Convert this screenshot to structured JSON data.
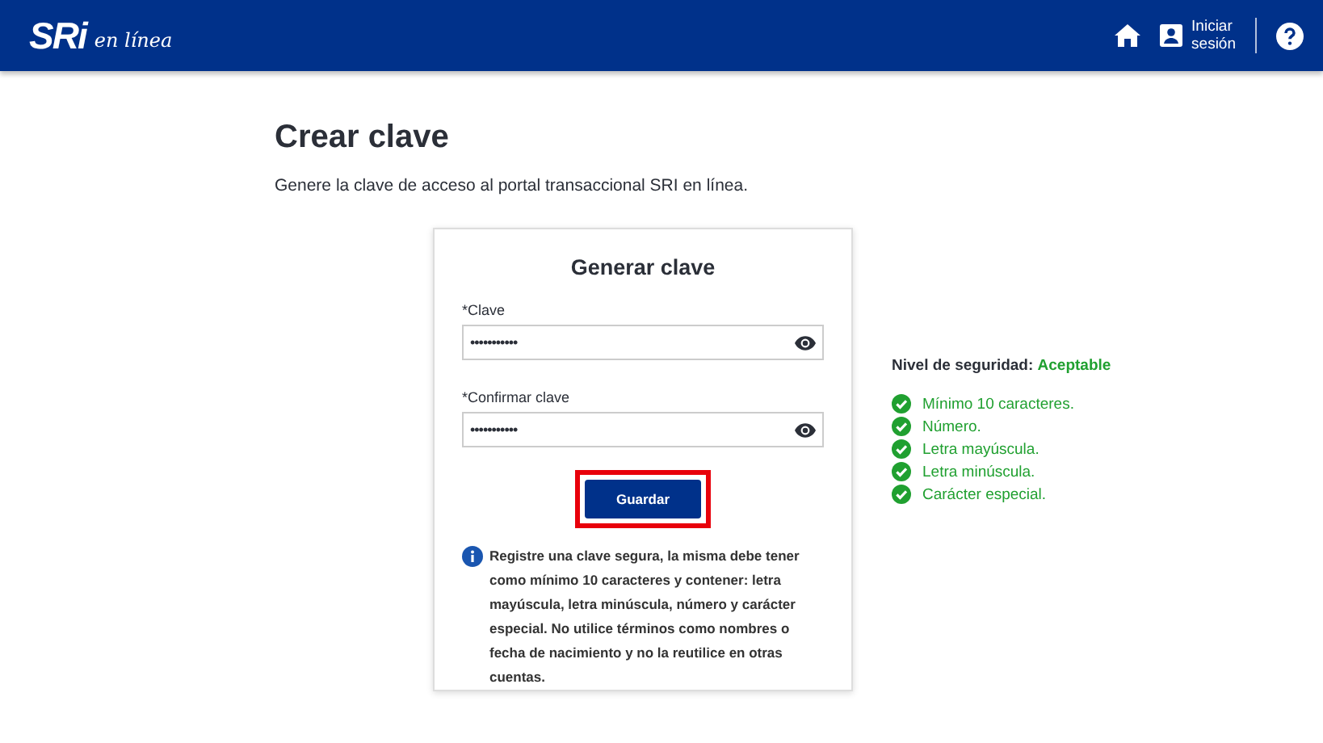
{
  "header": {
    "logo": "SRi",
    "logo_sub": "en línea",
    "login": [
      "Iniciar",
      "sesión"
    ]
  },
  "page": {
    "title": "Crear clave",
    "subtitle": "Genere la clave de acceso al portal transaccional SRI en línea."
  },
  "card": {
    "title": "Generar clave",
    "fields": [
      {
        "label": "*Clave",
        "value": "•••••••••••"
      },
      {
        "label": "*Confirmar clave",
        "value": "•••••••••••"
      }
    ],
    "button": {
      "label": "Guardar",
      "highlighted": true
    },
    "info": "Registre una clave segura, la misma debe tener como mínimo 10 caracteres y contener: letra mayúscula, letra minúscula, número y carácter especial. No utilice términos como nombres o fecha de nacimiento y no la reutilice en otras cuentas."
  },
  "security": {
    "label": "Nivel de seguridad:",
    "level": "Aceptable",
    "rules": [
      {
        "text": "Mínimo 10 caracteres.",
        "met": true
      },
      {
        "text": "Número.",
        "met": true
      },
      {
        "text": "Letra mayúscula.",
        "met": true
      },
      {
        "text": "Letra minúscula.",
        "met": true
      },
      {
        "text": "Carácter especial.",
        "met": true
      }
    ]
  }
}
